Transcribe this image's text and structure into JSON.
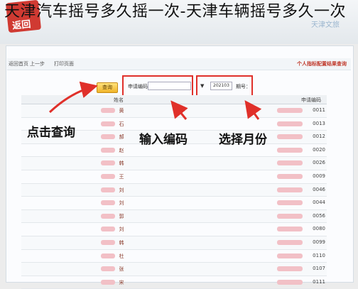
{
  "headline": "天津汽车摇号多久摇一次-天津车辆摇号多久一次",
  "logo_text": "返回",
  "watermark": "天津文旅",
  "toolbar": {
    "btn1": "返回首页",
    "btn2": "上一步",
    "btn3": "打印页面",
    "title": "个人指标配置结果查询"
  },
  "filters": {
    "issue_label": "期号：",
    "issue_value": "202103",
    "code_label": "申请编码：",
    "code_value": "",
    "search_button": "查询"
  },
  "table": {
    "col_name": "姓名",
    "col_code": "申请编码",
    "names": [
      "黄",
      "石",
      "郝",
      "赵",
      "韩",
      "王",
      "刘",
      "刘",
      "郭",
      "刘",
      "韩",
      "杜",
      "张",
      "宋"
    ],
    "codes": [
      "0011",
      "0013",
      "0012",
      "0020",
      "0026",
      "0009",
      "0046",
      "0044",
      "0056",
      "0080",
      "0099",
      "0110",
      "0107",
      "0111"
    ]
  },
  "annotations": {
    "click_query": "点击查询",
    "input_code": "输入编码",
    "select_month": "选择月份"
  },
  "colors": {
    "accent_red": "#e0302a",
    "button_yellow": "#f0b42a"
  }
}
